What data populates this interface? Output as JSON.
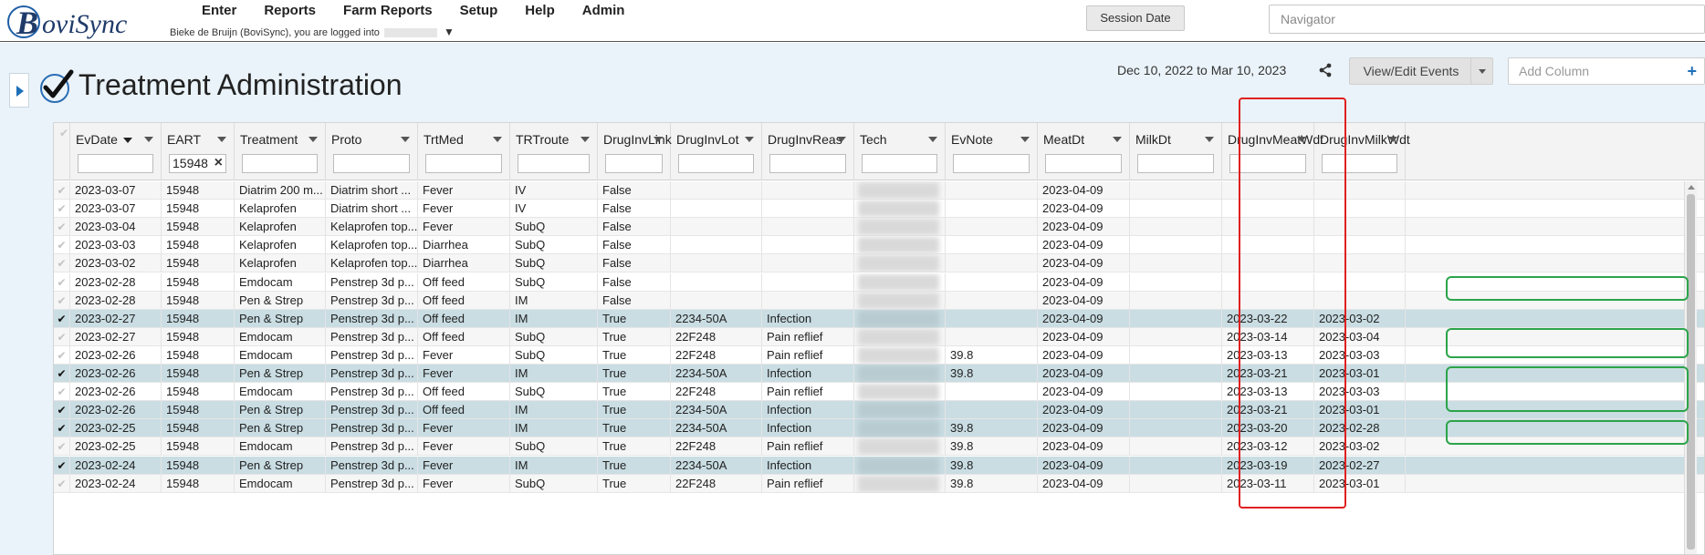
{
  "app": {
    "logo_letter": "B",
    "logo_rest": "oviSync",
    "logo_label": "BoviSync"
  },
  "menu": [
    "Enter",
    "Reports",
    "Farm Reports",
    "Setup",
    "Help",
    "Admin"
  ],
  "user": {
    "logged_in_text": "Bieke de Bruijn (BoviSync), you are logged into"
  },
  "session_button": "Session Date",
  "navigator_placeholder": "Navigator",
  "page": {
    "title": "Treatment Administration",
    "date_range": "Dec 10, 2022 to Mar 10, 2023",
    "view_edit_label": "View/Edit Events",
    "add_column_placeholder": "Add Column"
  },
  "columns": [
    {
      "name": "EvDate",
      "filter": "",
      "sorted": true
    },
    {
      "name": "EART",
      "filter": "15948",
      "sorted": false
    },
    {
      "name": "Treatment",
      "filter": "",
      "sorted": false
    },
    {
      "name": "Proto",
      "filter": "",
      "sorted": false
    },
    {
      "name": "TrtMed",
      "filter": "",
      "sorted": false
    },
    {
      "name": "TRTroute",
      "filter": "",
      "sorted": false
    },
    {
      "name": "DrugInvLink",
      "filter": "",
      "sorted": false
    },
    {
      "name": "DrugInvLot",
      "filter": "",
      "sorted": false
    },
    {
      "name": "DrugInvReas",
      "filter": "",
      "sorted": false
    },
    {
      "name": "Tech",
      "filter": "",
      "sorted": false
    },
    {
      "name": "EvNote",
      "filter": "",
      "sorted": false
    },
    {
      "name": "MeatDt",
      "filter": "",
      "sorted": false
    },
    {
      "name": "MilkDt",
      "filter": "",
      "sorted": false
    },
    {
      "name": "DrugInvMeatWdt",
      "filter": "",
      "sorted": false
    },
    {
      "name": "DrugInvMilkWdt",
      "filter": "",
      "sorted": false
    }
  ],
  "rows": [
    {
      "selected": false,
      "cells": [
        "2023-03-07",
        "15948",
        "Diatrim 200 m...",
        "Diatrim short ...",
        "Fever",
        "IV",
        "False",
        "",
        "",
        "",
        "",
        "2023-04-09",
        "",
        "",
        ""
      ]
    },
    {
      "selected": false,
      "cells": [
        "2023-03-07",
        "15948",
        "Kelaprofen",
        "Diatrim short ...",
        "Fever",
        "IV",
        "False",
        "",
        "",
        "",
        "",
        "2023-04-09",
        "",
        "",
        ""
      ]
    },
    {
      "selected": false,
      "cells": [
        "2023-03-04",
        "15948",
        "Kelaprofen",
        "Kelaprofen top...",
        "Fever",
        "SubQ",
        "False",
        "",
        "",
        "",
        "",
        "2023-04-09",
        "",
        "",
        ""
      ]
    },
    {
      "selected": false,
      "cells": [
        "2023-03-03",
        "15948",
        "Kelaprofen",
        "Kelaprofen top...",
        "Diarrhea",
        "SubQ",
        "False",
        "",
        "",
        "",
        "",
        "2023-04-09",
        "",
        "",
        ""
      ]
    },
    {
      "selected": false,
      "cells": [
        "2023-03-02",
        "15948",
        "Kelaprofen",
        "Kelaprofen top...",
        "Diarrhea",
        "SubQ",
        "False",
        "",
        "",
        "",
        "",
        "2023-04-09",
        "",
        "",
        ""
      ]
    },
    {
      "selected": false,
      "cells": [
        "2023-02-28",
        "15948",
        "Emdocam",
        "Penstrep 3d p...",
        "Off feed",
        "SubQ",
        "False",
        "",
        "",
        "",
        "",
        "2023-04-09",
        "",
        "",
        ""
      ]
    },
    {
      "selected": false,
      "cells": [
        "2023-02-28",
        "15948",
        "Pen & Strep",
        "Penstrep 3d p...",
        "Off feed",
        "IM",
        "False",
        "",
        "",
        "",
        "",
        "2023-04-09",
        "",
        "",
        ""
      ]
    },
    {
      "selected": true,
      "cells": [
        "2023-02-27",
        "15948",
        "Pen & Strep",
        "Penstrep 3d p...",
        "Off feed",
        "IM",
        "True",
        "2234-50A",
        "Infection",
        "",
        "",
        "2023-04-09",
        "",
        "2023-03-22",
        "2023-03-02"
      ]
    },
    {
      "selected": false,
      "cells": [
        "2023-02-27",
        "15948",
        "Emdocam",
        "Penstrep 3d p...",
        "Off feed",
        "SubQ",
        "True",
        "22F248",
        "Pain reflief",
        "",
        "",
        "2023-04-09",
        "",
        "2023-03-14",
        "2023-03-04"
      ]
    },
    {
      "selected": false,
      "cells": [
        "2023-02-26",
        "15948",
        "Emdocam",
        "Penstrep 3d p...",
        "Fever",
        "SubQ",
        "True",
        "22F248",
        "Pain reflief",
        "",
        "39.8",
        "2023-04-09",
        "",
        "2023-03-13",
        "2023-03-03"
      ]
    },
    {
      "selected": true,
      "cells": [
        "2023-02-26",
        "15948",
        "Pen & Strep",
        "Penstrep 3d p...",
        "Fever",
        "IM",
        "True",
        "2234-50A",
        "Infection",
        "",
        "39.8",
        "2023-04-09",
        "",
        "2023-03-21",
        "2023-03-01"
      ]
    },
    {
      "selected": false,
      "cells": [
        "2023-02-26",
        "15948",
        "Emdocam",
        "Penstrep 3d p...",
        "Off feed",
        "SubQ",
        "True",
        "22F248",
        "Pain reflief",
        "",
        "",
        "2023-04-09",
        "",
        "2023-03-13",
        "2023-03-03"
      ]
    },
    {
      "selected": true,
      "cells": [
        "2023-02-26",
        "15948",
        "Pen & Strep",
        "Penstrep 3d p...",
        "Off feed",
        "IM",
        "True",
        "2234-50A",
        "Infection",
        "",
        "",
        "2023-04-09",
        "",
        "2023-03-21",
        "2023-03-01"
      ]
    },
    {
      "selected": true,
      "cells": [
        "2023-02-25",
        "15948",
        "Pen & Strep",
        "Penstrep 3d p...",
        "Fever",
        "IM",
        "True",
        "2234-50A",
        "Infection",
        "",
        "39.8",
        "2023-04-09",
        "",
        "2023-03-20",
        "2023-02-28"
      ]
    },
    {
      "selected": false,
      "cells": [
        "2023-02-25",
        "15948",
        "Emdocam",
        "Penstrep 3d p...",
        "Fever",
        "SubQ",
        "True",
        "22F248",
        "Pain reflief",
        "",
        "39.8",
        "2023-04-09",
        "",
        "2023-03-12",
        "2023-03-02"
      ]
    },
    {
      "selected": true,
      "cells": [
        "2023-02-24",
        "15948",
        "Pen & Strep",
        "Penstrep 3d p...",
        "Fever",
        "IM",
        "True",
        "2234-50A",
        "Infection",
        "",
        "39.8",
        "2023-04-09",
        "",
        "2023-03-19",
        "2023-02-27"
      ]
    },
    {
      "selected": false,
      "cells": [
        "2023-02-24",
        "15948",
        "Emdocam",
        "Penstrep 3d p...",
        "Fever",
        "SubQ",
        "True",
        "22F248",
        "Pain reflief",
        "",
        "39.8",
        "2023-04-09",
        "",
        "2023-03-11",
        "2023-03-01"
      ]
    }
  ],
  "colors": {
    "selected_row": "#c9dde3",
    "red_highlight": "#e02020",
    "green_highlight": "#2ca44a",
    "accent": "#1e6fb8"
  }
}
